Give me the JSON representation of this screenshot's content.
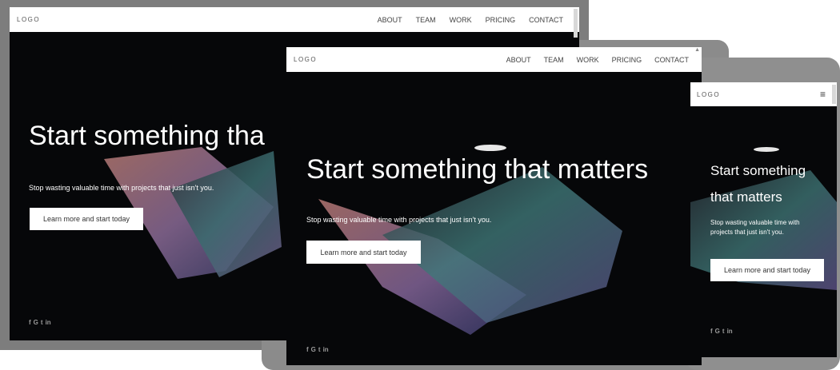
{
  "brand": {
    "logo": "LOGO"
  },
  "nav": {
    "items": [
      "ABOUT",
      "TEAM",
      "WORK",
      "PRICING",
      "CONTACT"
    ],
    "menu_glyph": "≡"
  },
  "hero": {
    "headline": "Start something that matters",
    "desktop_headline": "Start something tha",
    "phone_headline_line1": "Start something",
    "phone_headline_line2": "that matters",
    "subheadline": "Stop wasting valuable time with projects that just isn't you.",
    "desktop_subheadline": "Stop wasting valuable time with projects that just isn't you.",
    "phone_sub_line1": "Stop wasting valuable time with",
    "phone_sub_line2": "projects that just isn't you.",
    "cta_label": "Learn more and start today"
  },
  "social": {
    "icons": [
      "facebook-icon",
      "google-plus-icon",
      "twitter-icon",
      "linkedin-icon"
    ],
    "glyphs": [
      "f",
      "G",
      "t",
      "in"
    ]
  },
  "colors": {
    "frame_desktop": "#7d7d7d",
    "frame_tablet": "#8b8b8b",
    "frame_phone": "#8f8f8f",
    "hero_bg": "#060709",
    "nav_bg": "#ffffff",
    "cta_bg": "#ffffff"
  }
}
